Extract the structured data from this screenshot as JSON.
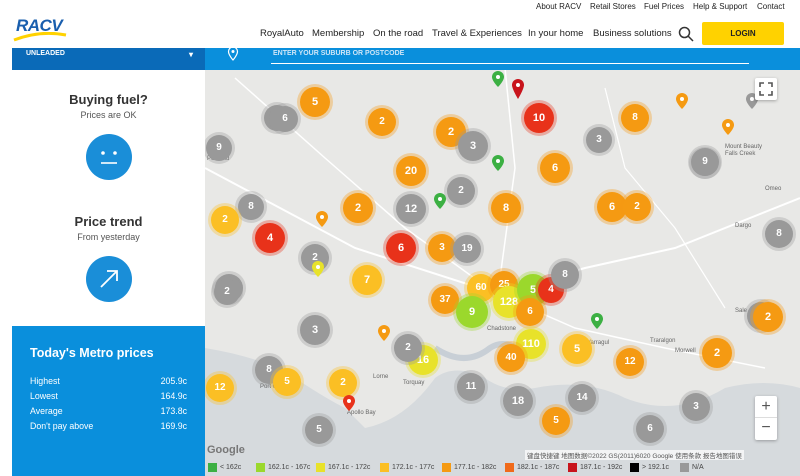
{
  "header": {
    "logo_text": "RACV",
    "utility_links": [
      "About RACV",
      "Retail Stores",
      "Fuel Prices",
      "Help & Support",
      "Contact"
    ],
    "nav_items": [
      "RoyalAuto",
      "Membership",
      "On the road",
      "Travel & Experiences",
      "In your home",
      "Business solutions"
    ],
    "search_icon": "search-icon",
    "login_label": "LOGIN"
  },
  "sidebar": {
    "fuel_type": "UNLEADED",
    "buying": {
      "title": "Buying fuel?",
      "subtitle": "Prices are OK",
      "icon": "neutral-face-icon"
    },
    "trend": {
      "title": "Price trend",
      "subtitle": "From yesterday",
      "icon": "arrow-up-right-icon"
    },
    "metro": {
      "title": "Today's Metro prices",
      "rows": [
        {
          "label": "Highest",
          "value": "205.9c"
        },
        {
          "label": "Lowest",
          "value": "164.9c"
        },
        {
          "label": "Average",
          "value": "173.8c"
        },
        {
          "label": "Don't pay above",
          "value": "169.9c"
        }
      ]
    }
  },
  "map": {
    "search_placeholder": "ENTER YOUR SUBURB OR POSTCODE",
    "zoom_in": "+",
    "zoom_out": "−",
    "fullscreen_icon": "fullscreen-icon",
    "google_logo": "Google",
    "attribution": "键盘快捷键  地图数据©2022 GS(2011)6020 Google  使用条款  报告地图错误",
    "place_labels": [
      "Port Campbell",
      "Torquay",
      "Lorne",
      "Apollo Bay",
      "Chadstone",
      "Warragul",
      "Traralgon",
      "Falls Creek",
      "Mount Beauty",
      "Dargo",
      "Omeo",
      "Morwell",
      "Sale",
      "Portland"
    ],
    "clusters": [
      {
        "n": "5",
        "c": "#f59a12"
      },
      {
        "n": "6",
        "c": "#999999"
      },
      {
        "n": "2",
        "c": "#f59a12"
      },
      {
        "n": "9",
        "c": "#999999"
      },
      {
        "n": "2",
        "c": "#f59a12"
      },
      {
        "n": "3",
        "c": "#999999"
      },
      {
        "n": "10",
        "c": "#e8321a"
      },
      {
        "n": "3",
        "c": "#999999"
      },
      {
        "n": "8",
        "c": "#f59a12"
      },
      {
        "n": "9",
        "c": "#999999"
      },
      {
        "n": "20",
        "c": "#f59a12"
      },
      {
        "n": "2",
        "c": "#999999"
      },
      {
        "n": "6",
        "c": "#f59a12"
      },
      {
        "n": "8",
        "c": "#999999"
      },
      {
        "n": "2",
        "c": "#fbbf24"
      },
      {
        "n": "2",
        "c": "#f59a12"
      },
      {
        "n": "12",
        "c": "#999999"
      },
      {
        "n": "8",
        "c": "#f59a12"
      },
      {
        "n": "6",
        "c": "#f59a12"
      },
      {
        "n": "4",
        "c": "#e8321a"
      },
      {
        "n": "2",
        "c": "#999999"
      },
      {
        "n": "6",
        "c": "#e8321a"
      },
      {
        "n": "3",
        "c": "#f59a12"
      },
      {
        "n": "19",
        "c": "#999999"
      },
      {
        "n": "7",
        "c": "#fbbf24"
      },
      {
        "n": "2",
        "c": "#999999"
      },
      {
        "n": "37",
        "c": "#f59a12"
      },
      {
        "n": "60",
        "c": "#fbbf24"
      },
      {
        "n": "25",
        "c": "#f59a12"
      },
      {
        "n": "128",
        "c": "#e8e22a"
      },
      {
        "n": "5",
        "c": "#9bd82c"
      },
      {
        "n": "4",
        "c": "#e8321a"
      },
      {
        "n": "8",
        "c": "#999999"
      },
      {
        "n": "9",
        "c": "#9bd82c"
      },
      {
        "n": "6",
        "c": "#f59a12"
      },
      {
        "n": "3",
        "c": "#999999"
      },
      {
        "n": "3",
        "c": "#999999"
      },
      {
        "n": "16",
        "c": "#e8e22a"
      },
      {
        "n": "110",
        "c": "#e8e22a"
      },
      {
        "n": "5",
        "c": "#fbbf24"
      },
      {
        "n": "40",
        "c": "#f59a12"
      },
      {
        "n": "12",
        "c": "#f59a12"
      },
      {
        "n": "2",
        "c": "#f59a12"
      },
      {
        "n": "2",
        "c": "#999999"
      },
      {
        "n": "8",
        "c": "#999999"
      },
      {
        "n": "5",
        "c": "#fbbf24"
      },
      {
        "n": "2",
        "c": "#fbbf24"
      },
      {
        "n": "12",
        "c": "#fbbf24"
      },
      {
        "n": "11",
        "c": "#999999"
      },
      {
        "n": "18",
        "c": "#999999"
      },
      {
        "n": "14",
        "c": "#999999"
      },
      {
        "n": "5",
        "c": "#f59a12"
      },
      {
        "n": "6",
        "c": "#999999"
      },
      {
        "n": "3",
        "c": "#999999"
      },
      {
        "n": "5",
        "c": "#999999"
      },
      {
        "n": "8",
        "c": "#999999"
      },
      {
        "n": "2",
        "c": "#f59a12"
      },
      {
        "n": "9",
        "c": "#999999"
      },
      {
        "n": "2",
        "c": "#f59a12"
      },
      {
        "n": "6",
        "c": "#999999"
      },
      {
        "n": "2",
        "c": "#999999"
      }
    ]
  },
  "legend": [
    {
      "label": "< 162c",
      "color": "#3cb043"
    },
    {
      "label": "162.1c - 167c",
      "color": "#9bd82c"
    },
    {
      "label": "167.1c - 172c",
      "color": "#e8e22a"
    },
    {
      "label": "172.1c - 177c",
      "color": "#fbbf24"
    },
    {
      "label": "177.1c - 182c",
      "color": "#f59a12"
    },
    {
      "label": "182.1c - 187c",
      "color": "#f06a1a"
    },
    {
      "label": "187.1c - 192c",
      "color": "#c8141c"
    },
    {
      "label": "> 192.1c",
      "color": "#000000"
    },
    {
      "label": "N/A",
      "color": "#999999"
    }
  ]
}
